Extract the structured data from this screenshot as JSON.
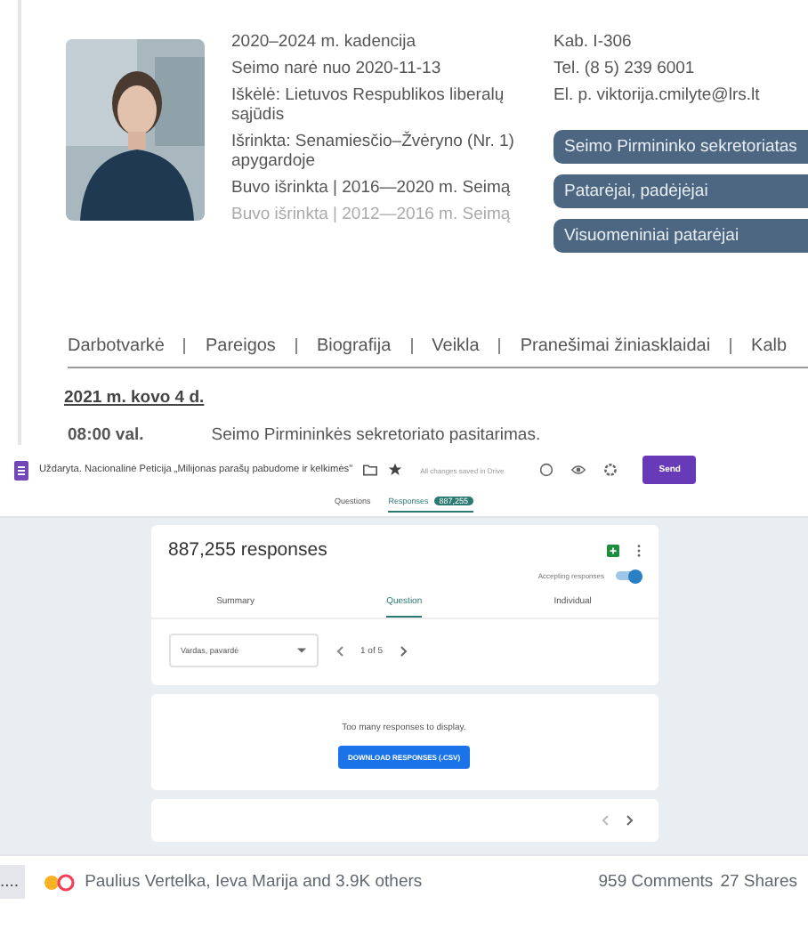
{
  "profile": {
    "details": [
      {
        "text": "2020–2024 m. kadencija",
        "muted": false
      },
      {
        "text": "Seimo narė nuo 2020-11-13",
        "muted": false
      },
      {
        "text": "Iškėlė: Lietuvos Respublikos liberalų sąjūdis",
        "muted": false
      },
      {
        "text": "Išrinkta: Senamiesčio–Žvėryno (Nr. 1) apygardoje",
        "muted": false
      },
      {
        "text": "Buvo išrinkta | 2016—2020 m. Seimą",
        "muted": false
      },
      {
        "text": "Buvo išrinkta | 2012—2016 m. Seimą",
        "muted": true
      }
    ],
    "contacts": [
      "Kab. I-306",
      "Tel. (8 5) 239 6001",
      "El. p. viktorija.cmilyte@lrs.lt"
    ],
    "buttons": [
      "Seimo Pirmininko sekretoriatas",
      "Patarėjai, padėjėjai",
      "Visuomeniniai patarėjai"
    ]
  },
  "nav": [
    "Darbotvarkė",
    "Pareigos",
    "Biografija",
    "Veikla",
    "Pranešimai žiniasklaidai",
    "Kalb"
  ],
  "agenda": {
    "date": "2021 m. kovo 4 d.",
    "time": "08:00 val.",
    "event": "Seimo Pirmininkės sekretoriato pasitarimas."
  },
  "form": {
    "title": "Uždaryta. Nacionalinė Peticija „Milijonas parašų pabudome ir kelkimės\"",
    "save_status": "All changes saved in Drive",
    "send": "Send",
    "tabs": [
      {
        "label": "Questions",
        "selected": false
      },
      {
        "label": "Responses",
        "selected": true,
        "badge": "887,255"
      }
    ],
    "responses_title": "887,255 responses",
    "accepting": {
      "label": "Accepting responses",
      "on": true
    },
    "view_tabs": [
      {
        "label": "Summary",
        "selected": false
      },
      {
        "label": "Question",
        "selected": true
      },
      {
        "label": "Individual",
        "selected": false
      }
    ],
    "question_select": "Vardas, pavardė",
    "pager": {
      "current": "1",
      "of": "of",
      "total": "5"
    },
    "notice": "Too many responses to display.",
    "download": "DOWNLOAD RESPONSES (.CSV)"
  },
  "post": {
    "more": "....",
    "reactions": "Paulius Vertelka, Ieva Marija and 3.9K others",
    "comments": "959 Comments",
    "shares": "27 Shares"
  }
}
